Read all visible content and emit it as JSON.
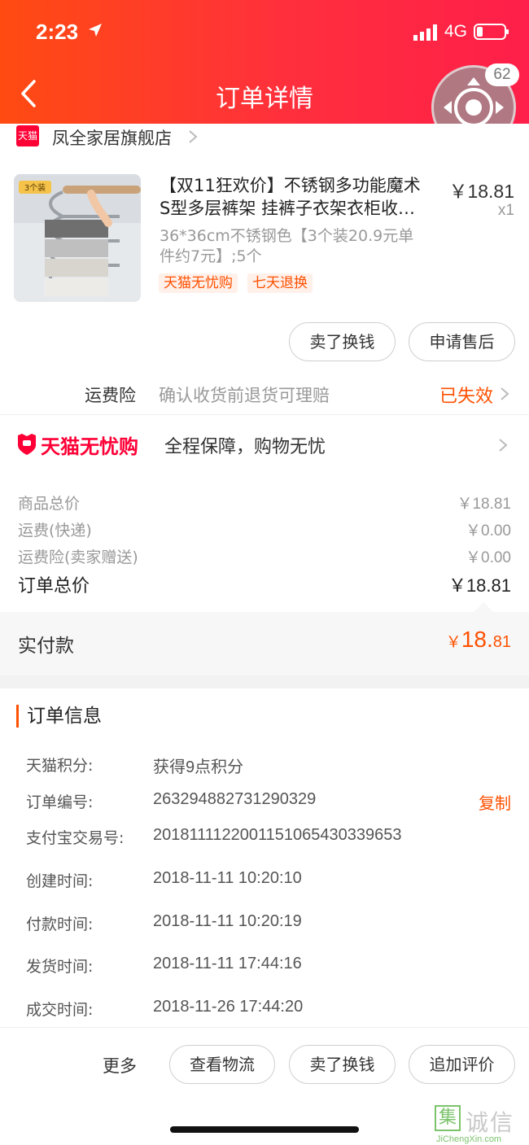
{
  "status_bar": {
    "time": "2:23",
    "network": "4G"
  },
  "header": {
    "title": "订单详情",
    "float_badge": "62"
  },
  "shop": {
    "logo_text": "天猫",
    "name": "凤全家居旗舰店"
  },
  "product": {
    "title_line1": "【双11狂欢价】不锈钢多功能魔术",
    "title_line2": "S型多层裤架 挂裤子衣架衣柜收…",
    "price": "￥18.81",
    "quantity": "x1",
    "sku_line1": "36*36cm不锈钢色【3个装20.9元单",
    "sku_line2": "件约7元】;5个",
    "image_tag": "3个装",
    "tags": [
      "天猫无忧购",
      "七天退换"
    ]
  },
  "actions": {
    "sell_for_cash": "卖了换钱",
    "after_sale": "申请售后"
  },
  "insurance": {
    "label": "运费险",
    "description": "确认收货前退货可理赔",
    "status": "已失效"
  },
  "worry_free": {
    "brand": "天猫无忧购",
    "description": "全程保障，购物无忧"
  },
  "price_breakdown": {
    "items": [
      {
        "label": "商品总价",
        "value": "￥18.81"
      },
      {
        "label": "运费(快递)",
        "value": "￥0.00"
      },
      {
        "label": "运费险(卖家赠送)",
        "value": "￥0.00"
      }
    ],
    "total_label": "订单总价",
    "total_value": "￥18.81",
    "paid_label": "实付款",
    "paid_currency": "￥",
    "paid_integer": "18.",
    "paid_decimal": "81"
  },
  "order_info": {
    "title": "订单信息",
    "copy_label": "复制",
    "rows": [
      {
        "key": "天猫积分:",
        "value": "获得9点积分"
      },
      {
        "key": "订单编号:",
        "value": "263294882731290329"
      },
      {
        "key": "支付宝交易号:",
        "value": "2018111122001151065430339653"
      },
      {
        "key": "创建时间:",
        "value": "2018-11-11 10:20:10"
      },
      {
        "key": "付款时间:",
        "value": "2018-11-11 10:20:19"
      },
      {
        "key": "发货时间:",
        "value": "2018-11-11 17:44:16"
      },
      {
        "key": "成交时间:",
        "value": "2018-11-26 17:44:20"
      }
    ]
  },
  "bottom_bar": {
    "more": "更多",
    "track": "查看物流",
    "sell_for_cash": "卖了换钱",
    "add_review": "追加评价"
  },
  "watermark": {
    "char": "集",
    "text": "诚信",
    "url": "JiChengXin.com"
  },
  "colors": {
    "accent": "#ff5000",
    "tmall_red": "#ff0036",
    "header_start": "#ff4b12",
    "header_end": "#ff1f4a"
  }
}
